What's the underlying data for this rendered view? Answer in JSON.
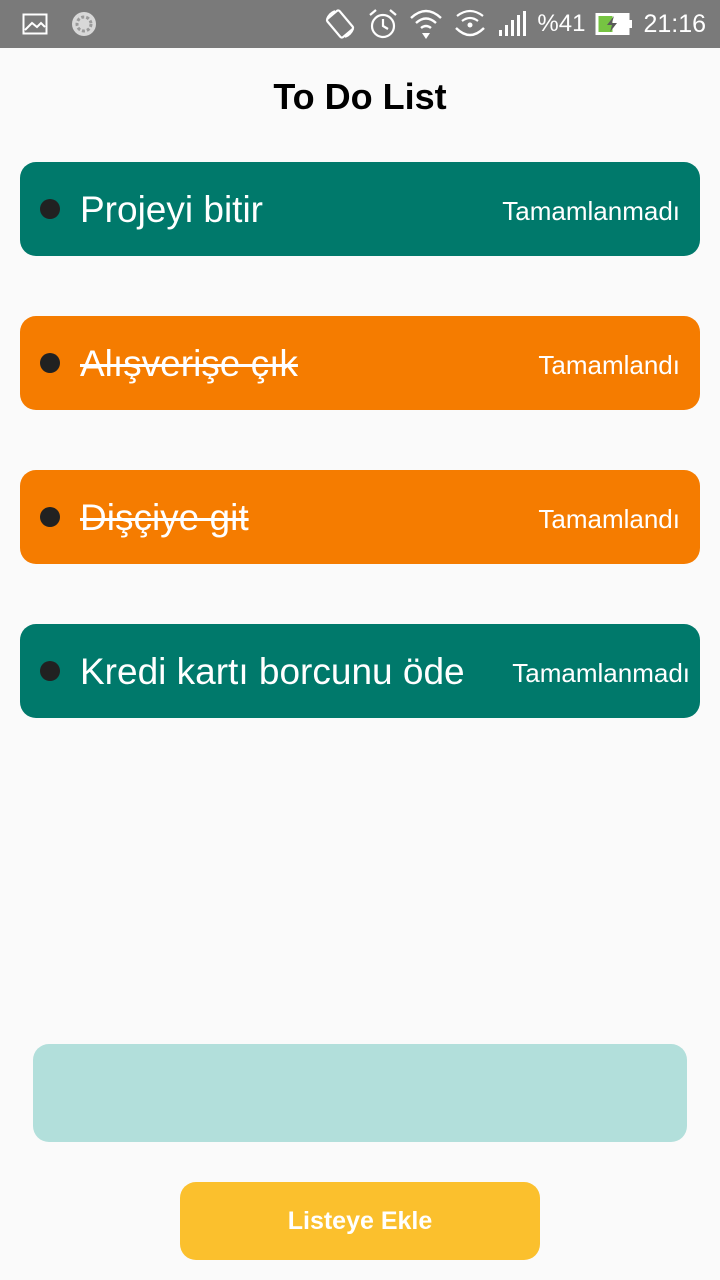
{
  "status_bar": {
    "battery_text": "%41",
    "time": "21:16",
    "icons": [
      "image-icon",
      "loading-icon",
      "rotate-icon",
      "alarm-icon",
      "wifi-icon",
      "hotspot-icon",
      "signal-icon",
      "battery-charging-icon"
    ]
  },
  "header": {
    "title": "To Do List"
  },
  "todos": [
    {
      "text": "Projeyi bitir",
      "status": "Tamamlanmadı",
      "done": false
    },
    {
      "text": "Alışverişe çık",
      "status": "Tamamlandı",
      "done": true
    },
    {
      "text": "Dişçiye git",
      "status": "Tamamlandı",
      "done": true
    },
    {
      "text": "Kredi kartı borcunu öde",
      "status": "Tamamlanmadı",
      "done": false
    }
  ],
  "input": {
    "value": "",
    "placeholder": ""
  },
  "add_button": {
    "label": "Listeye Ekle"
  },
  "colors": {
    "pending": "#00796b",
    "done": "#f57c00",
    "input_bg": "#b2dfdb",
    "button_bg": "#fbc02d",
    "status_bar": "#7a7a7a"
  }
}
